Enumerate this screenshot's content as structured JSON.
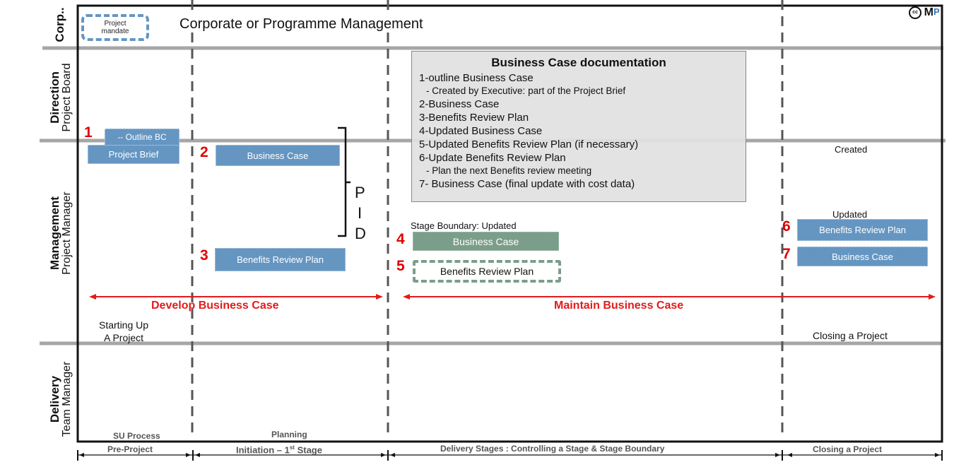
{
  "lanes": [
    {
      "id": "corp",
      "bold": "Corp..",
      "regular": ""
    },
    {
      "id": "direction",
      "bold": "Direction",
      "regular": "Project Board"
    },
    {
      "id": "management",
      "bold": "Management",
      "regular": "Project Manager"
    },
    {
      "id": "delivery",
      "bold": "Delivery",
      "regular": "Team Manager"
    }
  ],
  "corp_title": "Corporate or Programme Management",
  "project_mandate": "Project mandate",
  "logo": {
    "cc": "cc",
    "m": "M",
    "p": "P"
  },
  "documentation_box": {
    "title": "Business Case documentation",
    "items": [
      {
        "text": "1-outline Business Case",
        "sub": false
      },
      {
        "text": "- Created by Executive: part of the Project Brief",
        "sub": true
      },
      {
        "text": "2-Business Case",
        "sub": false
      },
      {
        "text": "3-Benefits Review Plan",
        "sub": false
      },
      {
        "text": "4-Updated Business Case",
        "sub": false
      },
      {
        "text": "5-Updated Benefits Review Plan (if necessary)",
        "sub": false
      },
      {
        "text": "6-Update Benefits Review Plan",
        "sub": false
      },
      {
        "text": "- Plan the next Benefits review meeting",
        "sub": true
      },
      {
        "text": "7- Business Case (final update with cost data)",
        "sub": false
      }
    ]
  },
  "documents": {
    "outline_bc": "-- Outline BC",
    "project_brief": "Project Brief",
    "business_case_2": "Business Case",
    "benefits_review_plan_3": "Benefits Review Plan",
    "business_case_4": "Business Case",
    "benefits_review_plan_5": "Benefits Review Plan",
    "benefits_review_plan_6": "Benefits Review Plan",
    "business_case_7": "Business Case"
  },
  "numbers": [
    "1",
    "2",
    "3",
    "4",
    "5",
    "6",
    "7"
  ],
  "pid_letters": [
    "P",
    "I",
    "D"
  ],
  "labels": {
    "stage_boundary_updated": "Stage Boundary: Updated",
    "created": "Created",
    "updated": "Updated",
    "starting_up_line1": "Starting Up",
    "starting_up_line2": "A Project",
    "closing_a_project": "Closing a Project"
  },
  "arrows": {
    "develop": "Develop Business Case",
    "maintain": "Maintain Business Case"
  },
  "process_labels": {
    "su_process": "SU Process",
    "planning": "Planning"
  },
  "phases": [
    {
      "label": "Pre-Project"
    },
    {
      "label": "Initiation – 1",
      "sup": "st",
      "suffix": " Stage"
    },
    {
      "label": "Delivery Stages : Controlling a Stage & Stage Boundary"
    },
    {
      "label": "Closing a Project"
    }
  ],
  "colors": {
    "doc_blue": "#6596c2",
    "doc_green": "#7b9e8a",
    "arrow_red": "#e21b1b",
    "number_red": "#e00000",
    "lane_divider": "#a6a6a6"
  }
}
